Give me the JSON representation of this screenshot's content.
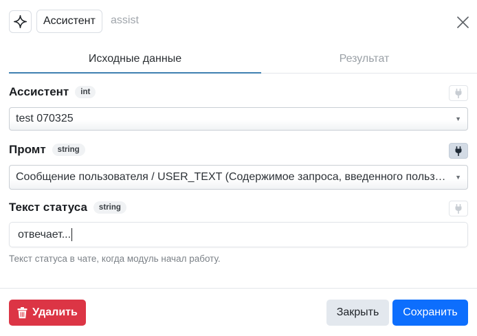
{
  "header": {
    "icon": "sparkle-icon",
    "title": "Ассистент",
    "subtitle": "assist",
    "close_icon": "close-icon"
  },
  "tabs": [
    {
      "label": "Исходные данные",
      "active": true
    },
    {
      "label": "Результат",
      "active": false
    }
  ],
  "fields": {
    "assistant": {
      "label": "Ассистент",
      "type": "int",
      "value": "test 070325",
      "plug_active": false
    },
    "prompt": {
      "label": "Промт",
      "type": "string",
      "value": "Сообщение пользователя / USER_TEXT (Содержимое запроса, введенного пользователем)",
      "plug_active": true
    },
    "status_text": {
      "label": "Текст статуса",
      "type": "string",
      "value": "отвечает...",
      "help": "Текст статуса в чате, когда модуль начал работу.",
      "plug_active": false
    }
  },
  "footer": {
    "delete_label": "Удалить",
    "close_label": "Закрыть",
    "save_label": "Сохранить"
  },
  "colors": {
    "accent": "#3d7fb0",
    "danger": "#dc3545",
    "primary": "#0d6efd",
    "secondary": "#e3e8ee"
  }
}
